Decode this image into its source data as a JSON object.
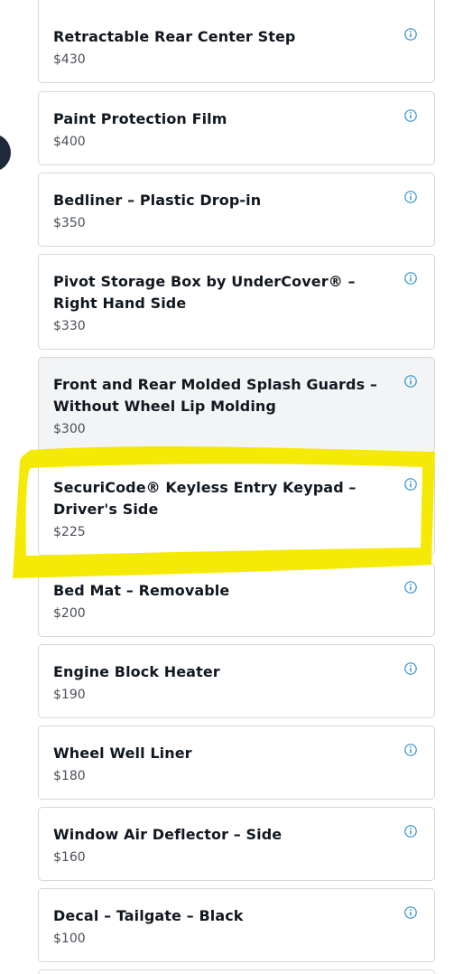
{
  "accessories": {
    "items": [
      {
        "title": "Retractable Rear Center Step",
        "price": "$430"
      },
      {
        "title": "Paint Protection Film",
        "price": "$400"
      },
      {
        "title": "Bedliner – Plastic Drop-in",
        "price": "$350"
      },
      {
        "title": "Pivot Storage Box by UnderCover® – Right Hand Side",
        "price": "$330"
      },
      {
        "title": "Front and Rear Molded Splash Guards – Without Wheel Lip Molding",
        "price": "$300"
      },
      {
        "title": "SecuriCode® Keyless Entry Keypad – Driver's Side",
        "price": "$225"
      },
      {
        "title": "Bed Mat – Removable",
        "price": "$200"
      },
      {
        "title": "Engine Block Heater",
        "price": "$190"
      },
      {
        "title": "Wheel Well Liner",
        "price": "$180"
      },
      {
        "title": "Window Air Deflector – Side",
        "price": "$160"
      },
      {
        "title": "Decal – Tailgate – Black",
        "price": "$100"
      }
    ]
  },
  "icons": {
    "info": "info-circle-icon"
  },
  "colors": {
    "info_icon": "#2f8fd0",
    "highlight": "#f5ea00",
    "side_dot": "#1e2a3b",
    "hover_card": "#f3f4f6"
  }
}
